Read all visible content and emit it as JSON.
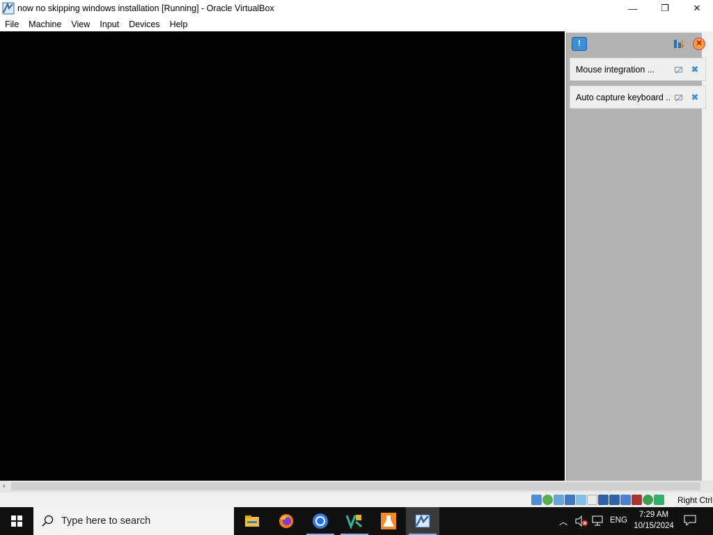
{
  "window": {
    "title": "now no skipping windows installation [Running] - Oracle VirtualBox",
    "controls": {
      "minimize": "—",
      "maximize": "❐",
      "close": "✕"
    }
  },
  "menu": {
    "items": [
      "File",
      "Machine",
      "View",
      "Input",
      "Devices",
      "Help"
    ]
  },
  "notification_center": {
    "notifications": [
      {
        "label": "Mouse integration ..."
      },
      {
        "label": "Auto capture keyboard ..."
      }
    ]
  },
  "statusbar": {
    "host_key": "Right Ctrl",
    "icons": [
      "hard-disk-icon",
      "optical-drive-icon",
      "audio-icon",
      "network-icon",
      "usb-icon",
      "shared-folders-icon",
      "display-icon",
      "recording-icon",
      "cpu-icon",
      "machine-icon",
      "mouse-integration-icon",
      "keyboard-capture-icon"
    ]
  },
  "taskbar": {
    "search_placeholder": "Type here to search",
    "apps": [
      "file-explorer-icon",
      "firefox-icon",
      "chrome-icon",
      "visual-studio-icon",
      "lab-flask-icon",
      "virtualbox-icon"
    ],
    "language": "ENG",
    "time": "7:29 AM",
    "date": "10/15/2024"
  },
  "colors": {
    "vm_background": "#000000",
    "panel_background": "#b3b3b3",
    "taskbar": "#101010",
    "accent": "#3c8fd6"
  }
}
